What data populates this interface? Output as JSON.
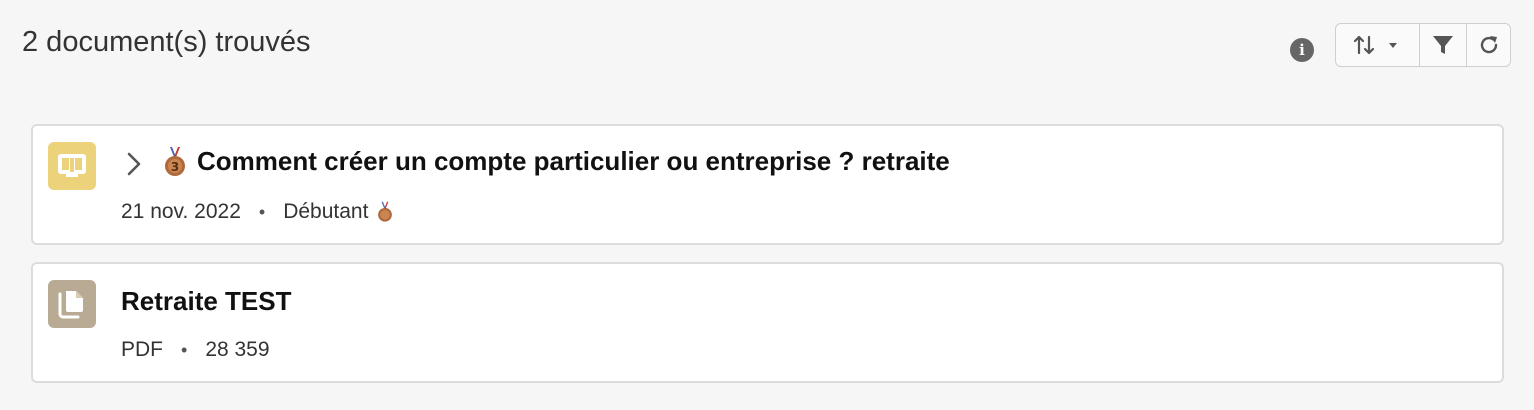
{
  "results": {
    "count_label": "2 document(s) trouvés"
  },
  "toolbar": {
    "info_icon": "info-icon",
    "info_glyph": "i",
    "sort_icon": "sort-icon",
    "filter_icon": "filter-icon",
    "refresh_icon": "refresh-icon"
  },
  "documents": [
    {
      "title": "Comment créer un compte particulier ou entreprise ? retraite",
      "date": "21 nov. 2022",
      "level": "Débutant",
      "icon": "book-icon",
      "icon_color": "#ecd27a",
      "medal_number": "3"
    },
    {
      "title": "Retraite TEST",
      "type": "PDF",
      "size": "28 359",
      "icon": "files-icon",
      "icon_color": "#b9ab93"
    }
  ],
  "colors": {
    "background": "#f6f6f6",
    "card_border": "#dcdcdc",
    "medal_bronze": "#b0693a"
  }
}
